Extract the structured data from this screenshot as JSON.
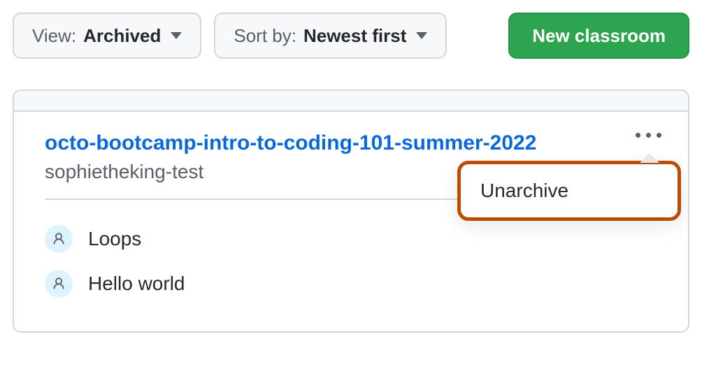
{
  "toolbar": {
    "view": {
      "label": "View:",
      "value": "Archived"
    },
    "sort": {
      "label": "Sort by:",
      "value": "Newest first"
    },
    "new_classroom_label": "New classroom"
  },
  "classroom": {
    "title": "octo-bootcamp-intro-to-coding-101-summer-2022",
    "organization": "sophietheking-test",
    "assignments": [
      {
        "name": "Loops"
      },
      {
        "name": "Hello world"
      }
    ],
    "menu": {
      "unarchive_label": "Unarchive"
    }
  }
}
